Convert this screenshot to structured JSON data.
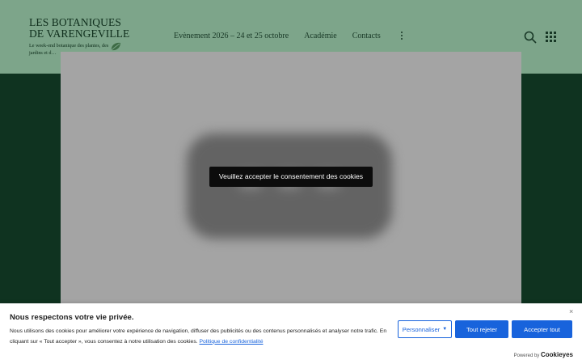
{
  "header": {
    "logo_line1": "LES BOTANIQUES",
    "logo_line2": "DE VARENGEVILLE",
    "logo_tagline": "Le week-end botanique des plantes, des jardins et d…",
    "nav": [
      "Evènement 2026 – 24 et 25 octobre",
      "Académie",
      "Contacts"
    ],
    "icons": [
      "leaf-logo-icon",
      "more-vertical-icon",
      "search-icon",
      "grid-apps-icon"
    ]
  },
  "content": {
    "consent_message": "Veuillez accepter le consentement des cookies"
  },
  "cookie_banner": {
    "title": "Nous respectons votre vie privée.",
    "text": "Nous utilisons des cookies pour améliorer votre expérience de navigation, diffuser des publicités ou des contenus personnalisés et analyser notre trafic. En cliquant sur « Tout accepter », vous consentez à notre utilisation des cookies.",
    "policy_link": "Politique de confidentialité",
    "buttons": {
      "customize": "Personnaliser",
      "reject": "Tout rejeter",
      "accept": "Accepter tout"
    },
    "close": "×",
    "powered_by": "Powered by",
    "brand": "Cookieyes"
  },
  "colors": {
    "header_bg": "#7da58a",
    "page_bg": "#0f3320",
    "accent": "#1863dc"
  }
}
